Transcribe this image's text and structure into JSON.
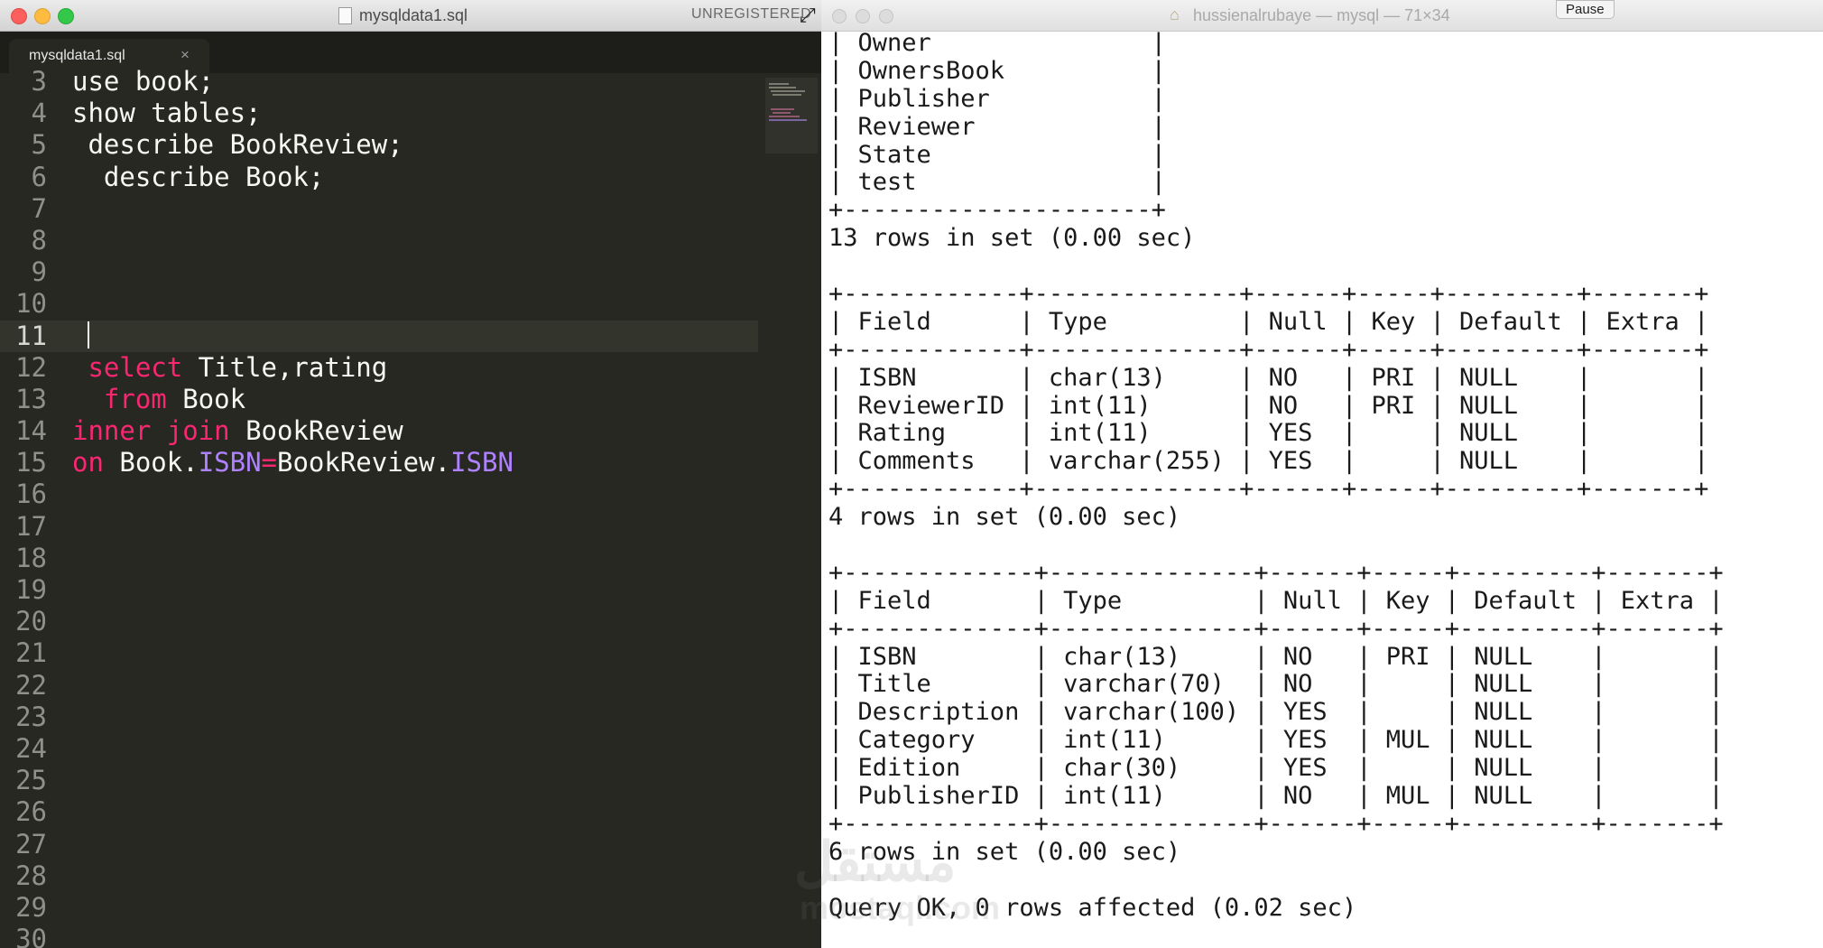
{
  "editor": {
    "window_title": "mysqldata1.sql",
    "unregistered": "UNREGISTERED",
    "tab_label": "mysqldata1.sql",
    "tab_close": "×",
    "lines": [
      {
        "num": "3",
        "segments": [
          {
            "t": "use book;",
            "c": ""
          }
        ]
      },
      {
        "num": "4",
        "segments": [
          {
            "t": "show tables;",
            "c": ""
          }
        ]
      },
      {
        "num": "5",
        "segments": [
          {
            "t": " describe BookReview;",
            "c": ""
          }
        ]
      },
      {
        "num": "6",
        "segments": [
          {
            "t": "  describe Book;",
            "c": ""
          }
        ]
      },
      {
        "num": "7",
        "segments": []
      },
      {
        "num": "8",
        "segments": []
      },
      {
        "num": "9",
        "segments": []
      },
      {
        "num": "10",
        "segments": []
      },
      {
        "num": "11",
        "segments": [],
        "current": true
      },
      {
        "num": "12",
        "segments": [
          {
            "t": " select",
            "c": "kw"
          },
          {
            "t": " Title,rating",
            "c": ""
          }
        ]
      },
      {
        "num": "13",
        "segments": [
          {
            "t": "  from",
            "c": "kw"
          },
          {
            "t": " Book",
            "c": ""
          }
        ]
      },
      {
        "num": "14",
        "segments": [
          {
            "t": "inner join",
            "c": "kw"
          },
          {
            "t": " BookReview",
            "c": ""
          }
        ]
      },
      {
        "num": "15",
        "segments": [
          {
            "t": "on",
            "c": "kw"
          },
          {
            "t": " Book.",
            "c": ""
          },
          {
            "t": "ISBN",
            "c": "prop"
          },
          {
            "t": "=",
            "c": "kw"
          },
          {
            "t": "BookReview.",
            "c": ""
          },
          {
            "t": "ISBN",
            "c": "prop"
          }
        ]
      },
      {
        "num": "16",
        "segments": []
      },
      {
        "num": "17",
        "segments": []
      },
      {
        "num": "18",
        "segments": []
      },
      {
        "num": "19",
        "segments": []
      },
      {
        "num": "20",
        "segments": []
      },
      {
        "num": "21",
        "segments": []
      },
      {
        "num": "22",
        "segments": []
      },
      {
        "num": "23",
        "segments": []
      },
      {
        "num": "24",
        "segments": []
      },
      {
        "num": "25",
        "segments": []
      },
      {
        "num": "26",
        "segments": []
      },
      {
        "num": "27",
        "segments": []
      },
      {
        "num": "28",
        "segments": []
      },
      {
        "num": "29",
        "segments": []
      },
      {
        "num": "30",
        "segments": []
      }
    ]
  },
  "terminal": {
    "title": "hussienalrubaye — mysql — 71×34",
    "pause_label": "Pause",
    "lines": [
      "| Owner               |",
      "| OwnersBook          |",
      "| Publisher           |",
      "| Reviewer            |",
      "| State               |",
      "| test                |",
      "+---------------------+",
      "13 rows in set (0.00 sec)",
      "",
      "+------------+--------------+------+-----+---------+-------+",
      "| Field      | Type         | Null | Key | Default | Extra |",
      "+------------+--------------+------+-----+---------+-------+",
      "| ISBN       | char(13)     | NO   | PRI | NULL    |       |",
      "| ReviewerID | int(11)      | NO   | PRI | NULL    |       |",
      "| Rating     | int(11)      | YES  |     | NULL    |       |",
      "| Comments   | varchar(255) | YES  |     | NULL    |       |",
      "+------------+--------------+------+-----+---------+-------+",
      "4 rows in set (0.00 sec)",
      "",
      "+-------------+--------------+------+-----+---------+-------+",
      "| Field       | Type         | Null | Key | Default | Extra |",
      "+-------------+--------------+------+-----+---------+-------+",
      "| ISBN        | char(13)     | NO   | PRI | NULL    |       |",
      "| Title       | varchar(70)  | NO   |     | NULL    |       |",
      "| Description | varchar(100) | YES  |     | NULL    |       |",
      "| Category    | int(11)      | YES  | MUL | NULL    |       |",
      "| Edition     | char(30)     | YES  |     | NULL    |       |",
      "| PublisherID | int(11)      | NO   | MUL | NULL    |       |",
      "+-------------+--------------+------+-----+---------+-------+",
      "6 rows in set (0.00 sec)",
      "",
      "Query OK, 0 rows affected (0.02 sec)"
    ]
  },
  "watermark": {
    "text": "مستقل",
    "sub": "mostaql.com"
  },
  "colors": {
    "editor_bg": "#272822",
    "keyword": "#f92672",
    "property": "#ae81ff",
    "gutter": "#90908a"
  }
}
